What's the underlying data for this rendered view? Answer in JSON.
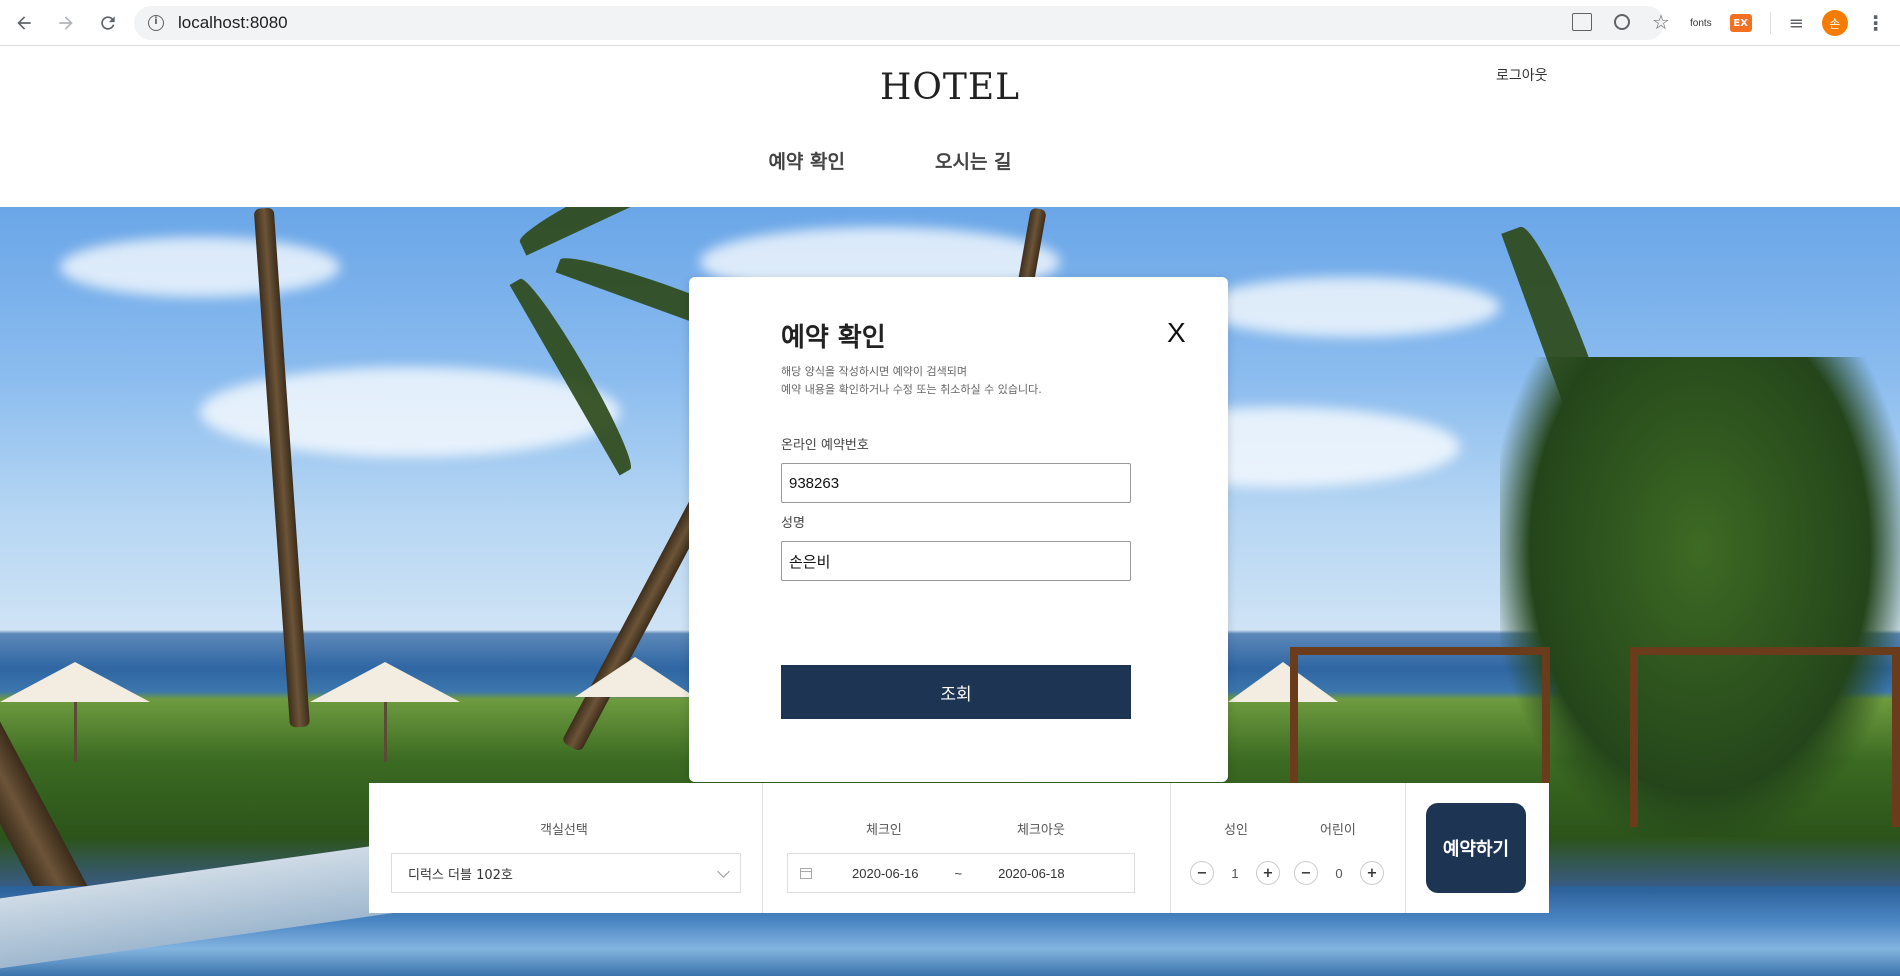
{
  "browser": {
    "url": "localhost:8080",
    "ext_fonts_label": "fonts",
    "ext_ex_label": "EX",
    "avatar_label": "손",
    "icons": [
      "back-icon",
      "forward-icon",
      "reload-icon",
      "info-icon",
      "translate-icon",
      "zoom-icon",
      "star-icon",
      "media-icon",
      "menu-icon"
    ]
  },
  "site": {
    "logo": "HOTEL",
    "logout": "로그아웃",
    "menu": [
      "예약 확인",
      "오시는 길"
    ]
  },
  "modal": {
    "title": "예약 확인",
    "close": "X",
    "desc_line1": "해당 양식을 작성하시면 예약이 검색되며",
    "desc_line2": "예약 내용을 확인하거나 수정 또는 취소하실 수 있습니다.",
    "reservation_label": "온라인 예약번호",
    "reservation_value": "938263",
    "name_label": "성명",
    "name_value": "손은비",
    "submit": "조회"
  },
  "booking": {
    "room_label": "객실선택",
    "room_value": "디럭스 더블 102호",
    "checkin_label": "체크인",
    "checkout_label": "체크아웃",
    "checkin_date": "2020-06-16",
    "tilde": "~",
    "checkout_date": "2020-06-18",
    "adult_label": "성인",
    "adult_value": "1",
    "child_label": "어린이",
    "child_value": "0",
    "minus": "−",
    "plus": "+",
    "reserve": "예약하기"
  },
  "colors": {
    "primary": "#1d3553",
    "avatar": "#f57c00",
    "ext_ex": "#f36f21"
  }
}
